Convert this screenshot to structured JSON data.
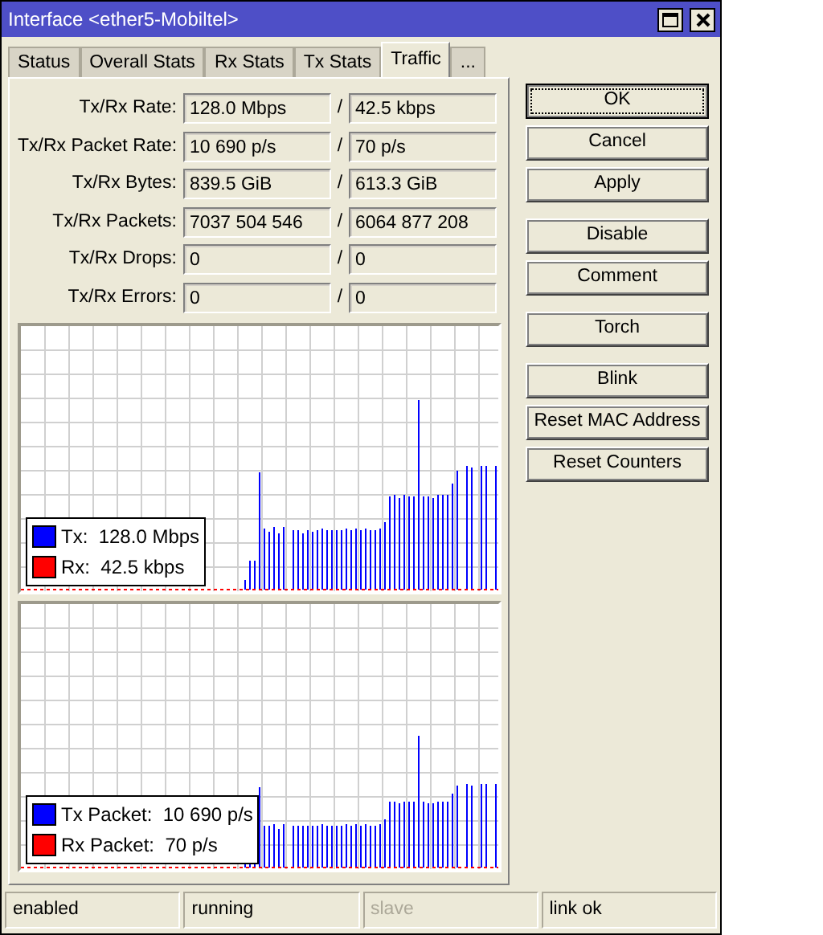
{
  "window": {
    "title": "Interface <ether5-Mobiltel>"
  },
  "tabs": [
    {
      "label": "Status",
      "selected": false
    },
    {
      "label": "Overall Stats",
      "selected": false
    },
    {
      "label": "Rx Stats",
      "selected": false
    },
    {
      "label": "Tx Stats",
      "selected": false
    },
    {
      "label": "Traffic",
      "selected": true
    },
    {
      "label": "...",
      "selected": false
    }
  ],
  "stats": [
    {
      "label": "Tx/Rx Rate:",
      "tx": "128.0 Mbps",
      "separator": "/",
      "rx": "42.5 kbps"
    },
    {
      "label": "Tx/Rx Packet Rate:",
      "tx": "10 690 p/s",
      "separator": "/",
      "rx": "70 p/s"
    },
    {
      "label": "Tx/Rx Bytes:",
      "tx": "839.5 GiB",
      "separator": "/",
      "rx": "613.3 GiB"
    },
    {
      "label": "Tx/Rx Packets:",
      "tx": "7037 504 546",
      "separator": "/",
      "rx": "6064 877 208"
    },
    {
      "label": "Tx/Rx Drops:",
      "tx": "0",
      "separator": "/",
      "rx": "0"
    },
    {
      "label": "Tx/Rx Errors:",
      "tx": "0",
      "separator": "/",
      "rx": "0"
    }
  ],
  "graphs": [
    {
      "legend": [
        {
          "text": "Tx:  128.0 Mbps",
          "color": "#0000ff"
        },
        {
          "text": "Rx:  42.5 kbps",
          "color": "#ff0000"
        }
      ]
    },
    {
      "legend": [
        {
          "text": "Tx Packet:  10 690 p/s",
          "color": "#0000ff"
        },
        {
          "text": "Rx Packet:  70 p/s",
          "color": "#ff0000"
        }
      ]
    }
  ],
  "button_groups": [
    [
      {
        "label": "OK",
        "focused": true
      },
      {
        "label": "Cancel",
        "focused": false
      },
      {
        "label": "Apply",
        "focused": false
      }
    ],
    [
      {
        "label": "Disable",
        "focused": false
      },
      {
        "label": "Comment",
        "focused": false
      }
    ],
    [
      {
        "label": "Torch",
        "focused": false
      }
    ],
    [
      {
        "label": "Blink",
        "focused": false
      },
      {
        "label": "Reset MAC Address",
        "focused": false
      },
      {
        "label": "Reset Counters",
        "focused": false
      }
    ]
  ],
  "status_bar": [
    {
      "text": "enabled",
      "disabled": false
    },
    {
      "text": "running",
      "disabled": false
    },
    {
      "text": "slave",
      "disabled": true
    },
    {
      "text": "link ok",
      "disabled": false
    }
  ]
}
